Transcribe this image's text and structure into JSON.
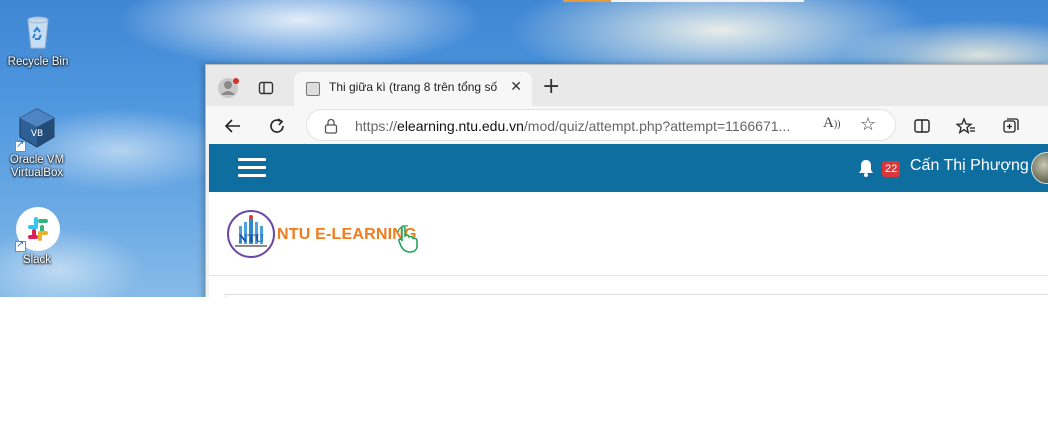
{
  "desktop": {
    "icons": [
      {
        "label": "Recycle Bin",
        "icon": "recycle-bin-icon"
      },
      {
        "label": "Oracle VM VirtualBox",
        "icon": "virtualbox-icon"
      },
      {
        "label": "Slack",
        "icon": "slack-icon"
      }
    ]
  },
  "browser": {
    "tab": {
      "title": "Thi giữa kì (trang 8 trên tổng số",
      "close_icon": "close-icon"
    },
    "address_bar": {
      "url_prefix": "https://",
      "url_host": "elearning.ntu.edu.vn",
      "url_path": "/mod/quiz/attempt.php?attempt=1166671..."
    }
  },
  "page": {
    "topnav": {
      "notification_count": "22",
      "user_name": "Cấn Thị Phượng"
    },
    "logo": {
      "text": "NTU E-LEARNING",
      "emblem_text": "NTU"
    }
  },
  "colors": {
    "navbar": "#0f6ea0",
    "logo_text": "#f07c1b",
    "badge": "#d9383a",
    "logo_ring": "#6b4aa7"
  }
}
